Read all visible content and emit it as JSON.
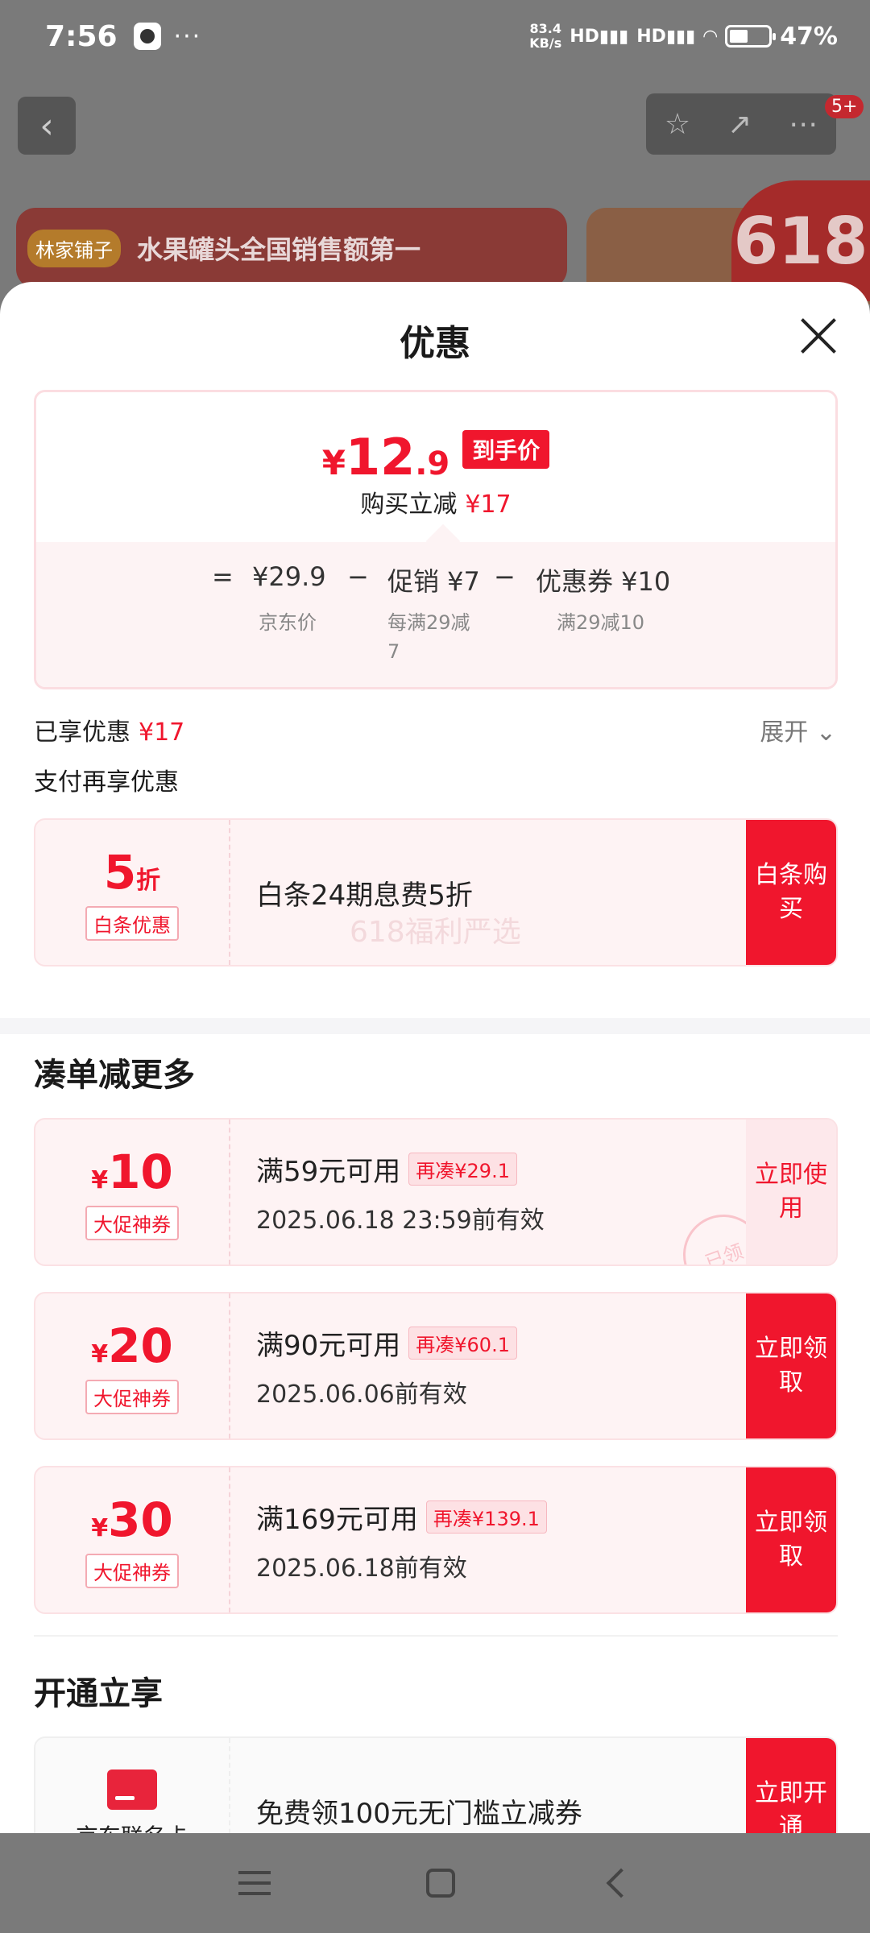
{
  "status_bar": {
    "time": "7:56",
    "dots": "···",
    "speed_value": "83.4",
    "speed_unit": "KB/s",
    "signal1": "HD",
    "signal2": "HD",
    "battery": "47%"
  },
  "background": {
    "cart_badge": "5+",
    "brand_logo": "林家铺子",
    "banner_text": "水果罐头全国销售额第一",
    "promo_618": "618"
  },
  "sheet": {
    "title": "优惠",
    "price": {
      "yen": "¥",
      "integer": "12",
      "decimal": ".9",
      "tag": "到手价",
      "instant_label": "购买立减",
      "instant_value": "¥17"
    },
    "calc": {
      "equals": "=",
      "jd_price": "¥29.9",
      "minus1": "−",
      "promo": "促销 ¥7",
      "minus2": "−",
      "coupon": "优惠券 ¥10",
      "jd_price_label": "京东价",
      "promo_desc": "每满29减7",
      "coupon_desc": "满29减10"
    },
    "enjoyed_label": "已享优惠",
    "enjoyed_value": "¥17",
    "expand_label": "展开",
    "pay_title": "支付再享优惠",
    "baitiao": {
      "amount": "5",
      "unit": "折",
      "label": "白条优惠",
      "text": "白条24期息费5折",
      "watermark": "618福利严选",
      "button": "白条购买"
    },
    "more_title": "凑单减更多",
    "coupons": [
      {
        "yen": "¥",
        "amount": "10",
        "label": "大促神券",
        "condition": "满59元可用",
        "extra": "再凑¥29.1",
        "date": "2025.06.18 23:59前有效",
        "button": "立即使用",
        "stamp": "已领"
      },
      {
        "yen": "¥",
        "amount": "20",
        "label": "大促神券",
        "condition": "满90元可用",
        "extra": "再凑¥60.1",
        "date": "2025.06.06前有效",
        "button": "立即领取"
      },
      {
        "yen": "¥",
        "amount": "30",
        "label": "大促神券",
        "condition": "满169元可用",
        "extra": "再凑¥139.1",
        "date": "2025.06.18前有效",
        "button": "立即领取"
      }
    ],
    "open_title": "开通立享",
    "member": {
      "icon_label": "京东联名卡",
      "text": "免费领100元无门槛立减券",
      "button": "立即开通"
    }
  },
  "colors": {
    "accent": "#f0162d",
    "card_bg": "#fef3f4"
  }
}
